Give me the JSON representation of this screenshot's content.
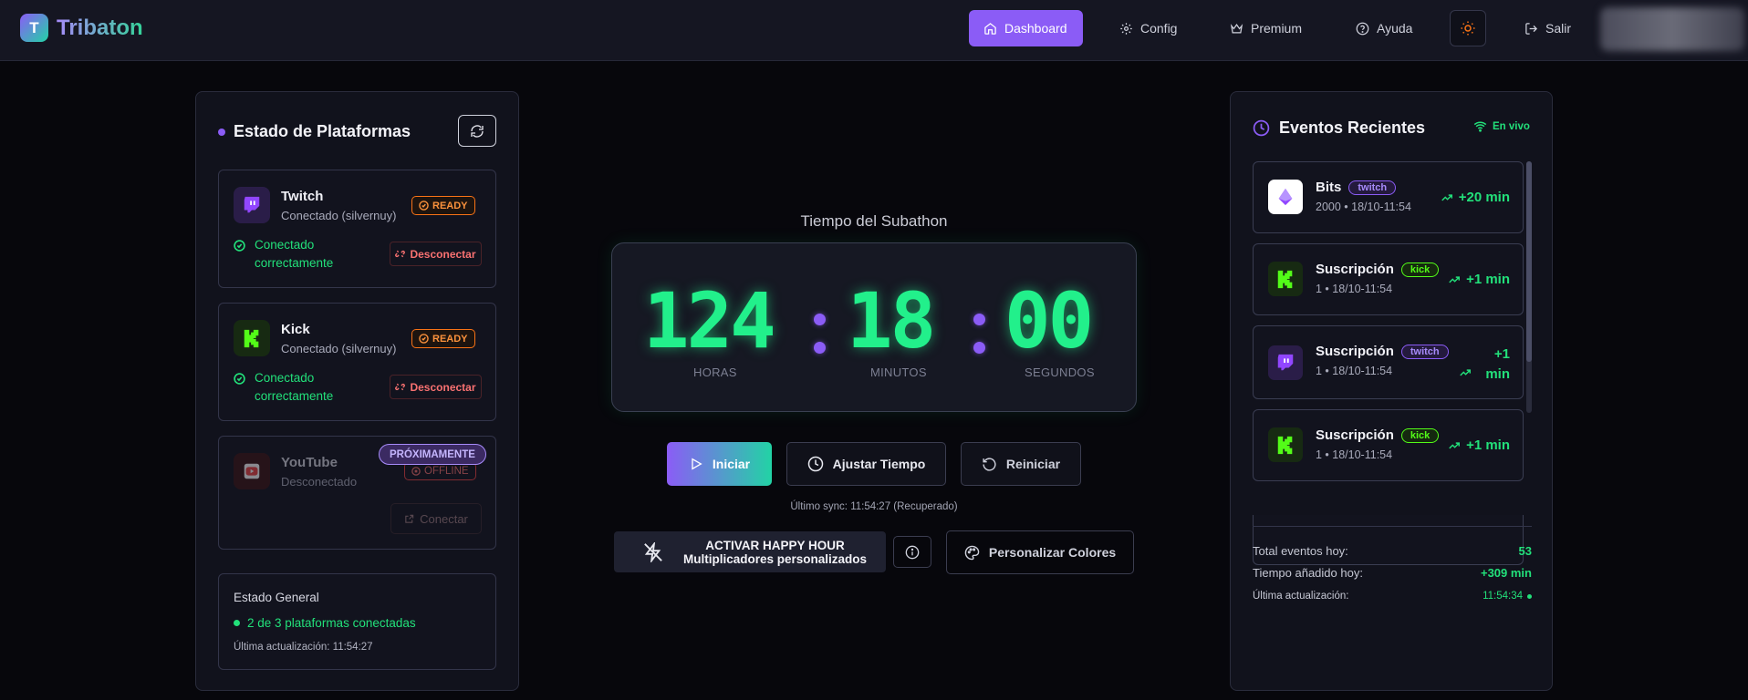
{
  "app": {
    "logo_letter": "T",
    "name": "Tribaton"
  },
  "nav": {
    "dashboard": "Dashboard",
    "config": "Config",
    "premium": "Premium",
    "ayuda": "Ayuda",
    "salir": "Salir"
  },
  "platforms": {
    "title": "Estado de Plataformas",
    "twitch": {
      "name": "Twitch",
      "status": "Conectado (silvernuy)",
      "badge": "READY",
      "ok": "Conectado correctamente",
      "action": "Desconectar"
    },
    "kick": {
      "name": "Kick",
      "status": "Conectado (silvernuy)",
      "badge": "READY",
      "ok": "Conectado correctamente",
      "action": "Desconectar"
    },
    "youtube": {
      "name": "YouTube",
      "status": "Desconectado",
      "soon": "PRÓXIMAMENTE",
      "badge": "OFFLINE",
      "action": "Conectar"
    },
    "general": {
      "title": "Estado General",
      "connected": "2 de 3 plataformas conectadas",
      "updated": "Última actualización: 11:54:27"
    }
  },
  "timer": {
    "title": "Tiempo del Subathon",
    "hours": "124",
    "minutes": "18",
    "seconds": "00",
    "hours_label": "HORAS",
    "minutes_label": "MINUTOS",
    "seconds_label": "SEGUNDOS",
    "start": "Iniciar",
    "adjust": "Ajustar Tiempo",
    "reset": "Reiniciar",
    "sync": "Último sync: 11:54:27 (Recuperado)",
    "happy_line1": "ACTIVAR HAPPY HOUR",
    "happy_line2": "Multiplicadores personalizados",
    "colors": "Personalizar Colores"
  },
  "events": {
    "title": "Eventos Recientes",
    "live": "En vivo",
    "items": [
      {
        "name": "Bits",
        "platform": "twitch",
        "meta": "2000 • 18/10-11:54",
        "added": "+20 min"
      },
      {
        "name": "Suscripción",
        "platform": "kick",
        "meta": "1 • 18/10-11:54",
        "added": "+1 min"
      },
      {
        "name": "Suscripción",
        "platform": "twitch",
        "meta": "1 • 18/10-11:54",
        "added": "+1 min"
      },
      {
        "name": "Suscripción",
        "platform": "kick",
        "meta": "1 • 18/10-11:54",
        "added": "+1 min"
      }
    ],
    "stats": {
      "total_label": "Total eventos hoy:",
      "total_value": "53",
      "time_label": "Tiempo añadido hoy:",
      "time_value": "+309 min",
      "updated_label": "Última actualización:",
      "updated_value": "11:54:34"
    }
  },
  "colors": {
    "accent": "#8b5cf6",
    "success": "#22e07a",
    "danger": "#f87171",
    "kick": "#53fc18",
    "twitch": "#9146ff"
  }
}
